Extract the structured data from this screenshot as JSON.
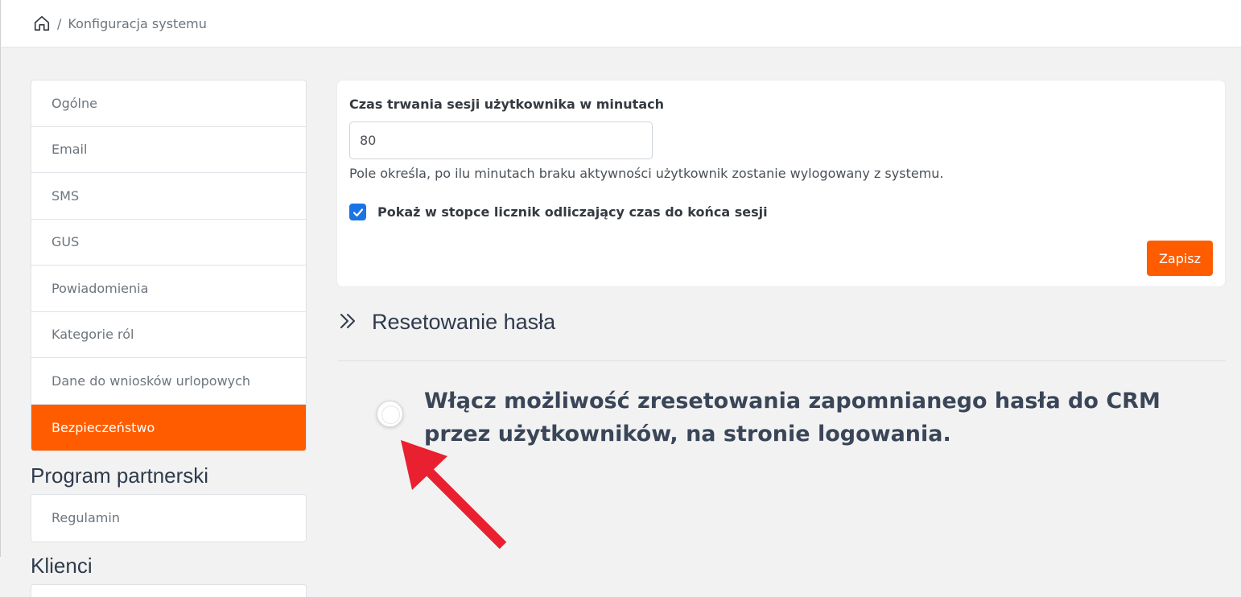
{
  "breadcrumb": {
    "separator": "/",
    "current": "Konfiguracja systemu"
  },
  "sidebar": {
    "items": [
      {
        "label": "Ogólne"
      },
      {
        "label": "Email"
      },
      {
        "label": "SMS"
      },
      {
        "label": "GUS"
      },
      {
        "label": "Powiadomienia"
      },
      {
        "label": "Kategorie ról"
      },
      {
        "label": "Dane do wniosków urlopowych"
      },
      {
        "label": "Bezpieczeństwo",
        "active": true
      }
    ],
    "partner_heading": "Program partnerski",
    "partner_items": [
      {
        "label": "Regulamin"
      }
    ],
    "clients_heading": "Klienci"
  },
  "session": {
    "label": "Czas trwania sesji użytkownika w minutach",
    "value": "80",
    "help": "Pole określa, po ilu minutach braku aktywności użytkownik zostanie wylogowany z systemu.",
    "countdown_label": "Pokaż w stopce licznik odliczający czas do końca sesji",
    "countdown_checked": true,
    "save_label": "Zapisz"
  },
  "reset": {
    "title": "Resetowanie hasła",
    "option_text": "Włącz możliwość zresetowania zapomnianego hasła do CRM przez użytkowników, na stronie logowania.",
    "option_checked": false
  },
  "colors": {
    "accent": "#ff5c00",
    "checkbox": "#1a73e8",
    "annotation_arrow": "#e8202f"
  }
}
